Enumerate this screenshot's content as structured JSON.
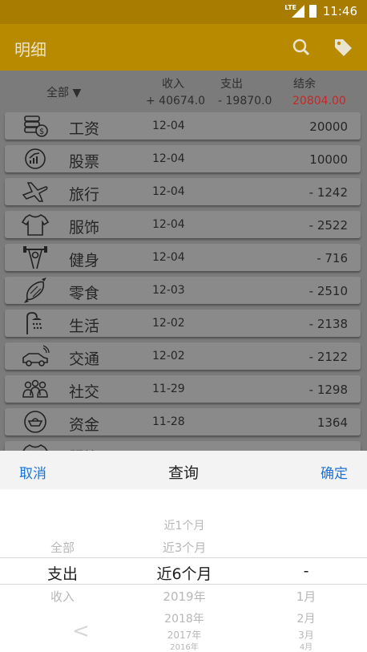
{
  "status": {
    "time": "11:46",
    "network": "LTE"
  },
  "appbar": {
    "title": "明细",
    "search_icon": "search-icon",
    "tag_icon": "tag-icon"
  },
  "summary": {
    "filter": "全部 ▼",
    "income_label": "收入",
    "expense_label": "支出",
    "balance_label": "结余",
    "income": "+ 40674.0",
    "expense": "- 19870.0",
    "balance": "20804.00",
    "balance_color": "#c62828"
  },
  "rows": [
    {
      "icon": "money-icon",
      "category": "工资",
      "date": "12-04",
      "amount": "20000"
    },
    {
      "icon": "stock-icon",
      "category": "股票",
      "date": "12-04",
      "amount": "10000"
    },
    {
      "icon": "airplane-icon",
      "category": "旅行",
      "date": "12-04",
      "amount": "- 1242"
    },
    {
      "icon": "shirt-icon",
      "category": "服饰",
      "date": "12-04",
      "amount": "- 2522"
    },
    {
      "icon": "fitness-icon",
      "category": "健身",
      "date": "12-04",
      "amount": "- 716"
    },
    {
      "icon": "candy-icon",
      "category": "零食",
      "date": "12-03",
      "amount": "- 2510"
    },
    {
      "icon": "shower-icon",
      "category": "生活",
      "date": "12-02",
      "amount": "- 2138"
    },
    {
      "icon": "car-icon",
      "category": "交通",
      "date": "12-02",
      "amount": "- 2122"
    },
    {
      "icon": "people-icon",
      "category": "社交",
      "date": "11-29",
      "amount": "- 1298"
    },
    {
      "icon": "ingot-icon",
      "category": "资金",
      "date": "11-28",
      "amount": "1364"
    },
    {
      "icon": "shirt-icon",
      "category": "服饰",
      "date": "",
      "amount": ""
    }
  ],
  "sheet": {
    "cancel": "取消",
    "title": "查询",
    "confirm": "确定",
    "type_col": {
      "above": "全部",
      "selected": "支出",
      "below": "收入"
    },
    "range_col": {
      "above2": "近1个月",
      "above1": "近3个月",
      "selected": "近6个月",
      "below1": "2019年",
      "below2": "2018年",
      "below3": "2017年",
      "below4": "2016年"
    },
    "month_col": {
      "selected": "-",
      "below1": "1月",
      "below2": "2月",
      "below3": "3月",
      "below4": "4月"
    },
    "back_glyph": "<"
  }
}
